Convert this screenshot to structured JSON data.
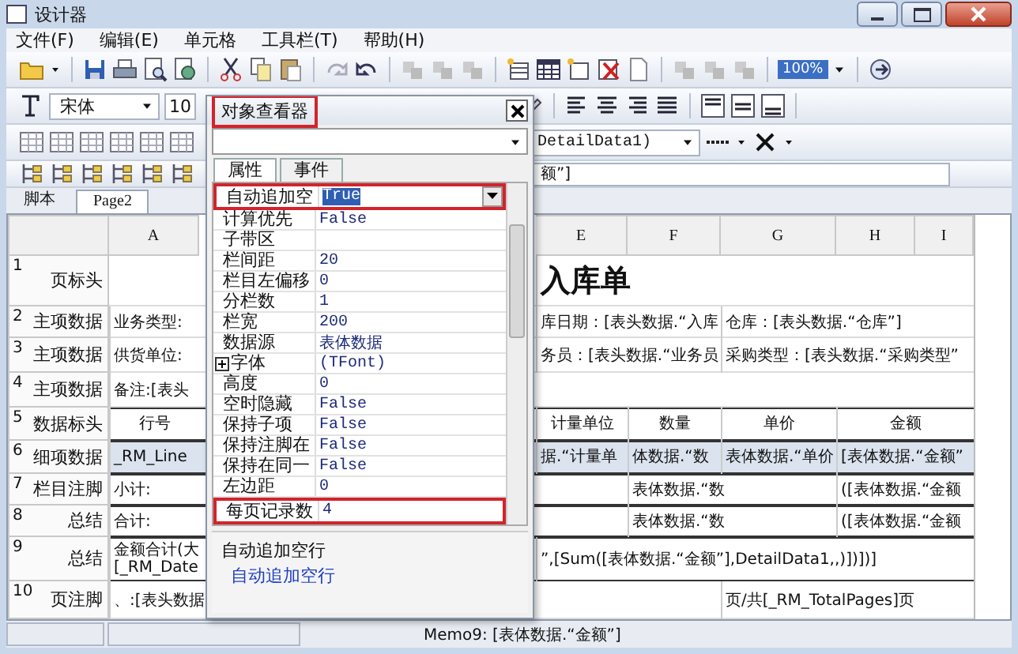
{
  "window": {
    "title": "设计器"
  },
  "menu": [
    {
      "label": "文件(F)"
    },
    {
      "label": "编辑(E)"
    },
    {
      "label": "单元格"
    },
    {
      "label": "工具栏(T)"
    },
    {
      "label": "帮助(H)"
    }
  ],
  "toolbar": {
    "zoom": "100%"
  },
  "format_bar": {
    "font": "宋体",
    "size": "10"
  },
  "band_bar": {
    "dataset": "DetailData1)"
  },
  "formula_bar": {
    "value": "额”]"
  },
  "sheet_tabs": [
    {
      "label": "脚本",
      "selected": false
    },
    {
      "label": "Page2",
      "selected": true
    }
  ],
  "sheet": {
    "columns": [
      {
        "label": "A"
      },
      {
        "label": "E"
      },
      {
        "label": "F"
      },
      {
        "label": "G"
      },
      {
        "label": "H"
      },
      {
        "label": "I"
      }
    ],
    "rows": [
      {
        "number": "1",
        "band": "页标头",
        "kind": "title",
        "selected": false,
        "boxed": false,
        "cells": [
          "",
          "入库单",
          "",
          "",
          "",
          ""
        ]
      },
      {
        "number": "2",
        "band": "主项数据",
        "kind": "data",
        "selected": false,
        "boxed": false,
        "cells": [
          "业务类型:",
          "库日期：[表头数据.“入库",
          "",
          "仓库：[表头数据.“仓库”]",
          "",
          ""
        ]
      },
      {
        "number": "3",
        "band": "主项数据",
        "kind": "data",
        "selected": false,
        "boxed": false,
        "cells": [
          "供货单位:",
          "务员：[表头数据.“业务员",
          "",
          "采购类型：[表头数据.“采购类型”",
          "",
          ""
        ]
      },
      {
        "number": "4",
        "band": "主项数据",
        "kind": "data",
        "selected": false,
        "boxed": false,
        "cells": [
          "备注:[表头",
          "",
          "",
          "",
          "",
          ""
        ]
      },
      {
        "number": "5",
        "band": "数据标头",
        "kind": "header",
        "selected": false,
        "boxed": true,
        "cells": [
          "行号",
          "计量单位",
          "数量",
          "单价",
          "金额",
          ""
        ]
      },
      {
        "number": "6",
        "band": "细项数据",
        "kind": "data",
        "selected": true,
        "boxed": true,
        "cells": [
          "_RM_Line",
          "据.“计量单",
          "体数据.“数",
          "表体数据.“单价",
          "[表体数据.“金额”",
          ""
        ]
      },
      {
        "number": "7",
        "band": "栏目注脚",
        "kind": "data",
        "selected": false,
        "boxed": true,
        "cells": [
          "小计:",
          "",
          "表体数据.“数",
          "",
          "([表体数据.“金额",
          ""
        ]
      },
      {
        "number": "8",
        "band": "总结",
        "kind": "data",
        "selected": false,
        "boxed": true,
        "cells": [
          "合计:",
          "",
          "表体数据.“数",
          "",
          "([表体数据.“金额",
          ""
        ]
      },
      {
        "number": "9",
        "band": "总结",
        "kind": "data",
        "selected": false,
        "boxed": true,
        "cells": [
          "金额合计(大\n[_RM_Date",
          "”,[Sum([表体数据.“金额”],DetailData1,,)])])]",
          "",
          "",
          "",
          ""
        ]
      },
      {
        "number": "10",
        "band": "页注脚",
        "kind": "data",
        "selected": false,
        "boxed": false,
        "cells": [
          "、:[表头数据",
          "",
          "",
          "页/共[_RM_TotalPages]页",
          "",
          ""
        ]
      }
    ]
  },
  "inspector": {
    "title": "对象查看器",
    "title_highlighted": true,
    "tabs": [
      {
        "label": "属性",
        "selected": true
      },
      {
        "label": "事件",
        "selected": false
      }
    ],
    "properties": [
      {
        "name": "自动追加空",
        "value": "True",
        "kind": "value",
        "selected": true,
        "highlighted": true
      },
      {
        "name": "计算优先",
        "value": "False",
        "kind": "value",
        "selected": false,
        "highlighted": false
      },
      {
        "name": "子带区",
        "kind": "value",
        "selected": false,
        "highlighted": false
      },
      {
        "name": "栏间距",
        "value": "20",
        "kind": "value",
        "selected": false,
        "highlighted": false
      },
      {
        "name": "栏目左偏移",
        "value": "0",
        "kind": "value",
        "selected": false,
        "highlighted": false
      },
      {
        "name": "分栏数",
        "value": "1",
        "kind": "value",
        "selected": false,
        "highlighted": false
      },
      {
        "name": "栏宽",
        "value": "200",
        "kind": "value",
        "selected": false,
        "highlighted": false
      },
      {
        "name": "数据源",
        "value": "表体数据",
        "kind": "value",
        "selected": false,
        "highlighted": false
      },
      {
        "name": "字体",
        "value": "(TFont)",
        "kind": "group",
        "expanded": false,
        "selected": false,
        "highlighted": false
      },
      {
        "name": "高度",
        "value": "0",
        "kind": "value",
        "selected": false,
        "highlighted": false
      },
      {
        "name": "空时隐藏",
        "value": "False",
        "kind": "value",
        "selected": false,
        "highlighted": false
      },
      {
        "name": "保持子项",
        "value": "False",
        "kind": "value",
        "selected": false,
        "highlighted": false
      },
      {
        "name": "保持注脚在",
        "value": "False",
        "kind": "value",
        "selected": false,
        "highlighted": false
      },
      {
        "name": "保持在同一",
        "value": "False",
        "kind": "value",
        "selected": false,
        "highlighted": false
      },
      {
        "name": "左边距",
        "value": "0",
        "kind": "value",
        "selected": false,
        "highlighted": false
      },
      {
        "name": "每页记录数",
        "value": "4",
        "kind": "value",
        "selected": false,
        "highlighted": true
      }
    ],
    "description": {
      "title": "自动追加空行",
      "link": "自动追加空行"
    }
  },
  "status_bar": {
    "text": "Memo9: [表体数据.“金额”]"
  }
}
